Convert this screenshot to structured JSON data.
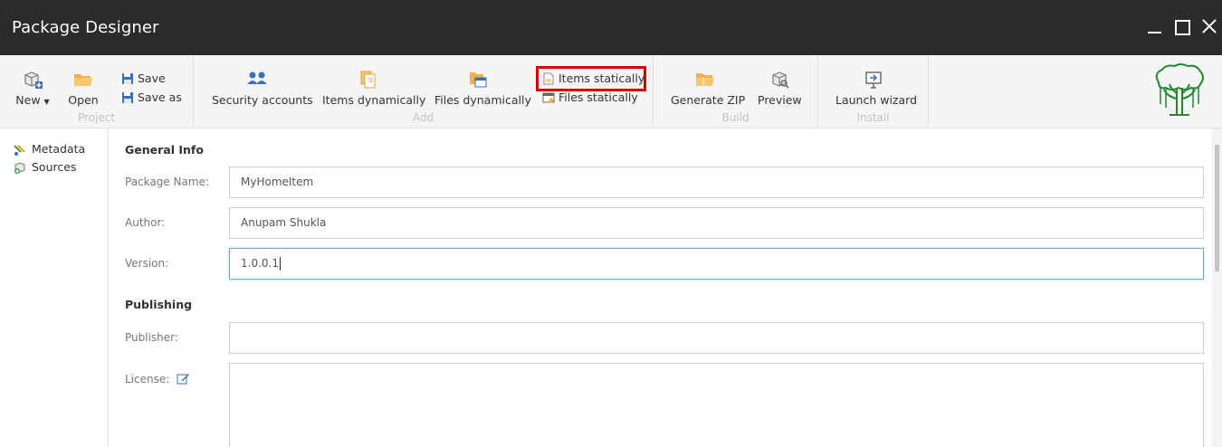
{
  "window": {
    "title": "Package Designer"
  },
  "ribbon": {
    "groups": {
      "project": "Project",
      "add": "Add",
      "build": "Build",
      "install": "Install"
    },
    "new_label": "New",
    "open_label": "Open",
    "save_label": "Save",
    "save_as_label": "Save as",
    "security_accounts_label": "Security accounts",
    "items_dynamically_label": "Items dynamically",
    "files_dynamically_label": "Files dynamically",
    "items_statically_label": "Items statically",
    "files_statically_label": "Files statically",
    "generate_zip_label": "Generate ZIP",
    "preview_label": "Preview",
    "launch_wizard_label": "Launch wizard"
  },
  "sidebar": {
    "items": [
      {
        "label": "Metadata",
        "icon": "metadata-icon"
      },
      {
        "label": "Sources",
        "icon": "sources-icon"
      }
    ]
  },
  "form": {
    "general_info_heading": "General Info",
    "package_name_label": "Package Name:",
    "package_name_value": "MyHomeItem",
    "author_label": "Author:",
    "author_value": "Anupam Shukla",
    "version_label": "Version:",
    "version_value": "1.0.0.1",
    "publishing_heading": "Publishing",
    "publisher_label": "Publisher:",
    "publisher_value": "",
    "license_label": "License:"
  },
  "colors": {
    "titlebar": "#2b2b2b",
    "ribbon_bg": "#f5f5f5",
    "highlight": "#d40000",
    "folder": "#f0b04a",
    "accent_blue": "#3b6fb6"
  }
}
